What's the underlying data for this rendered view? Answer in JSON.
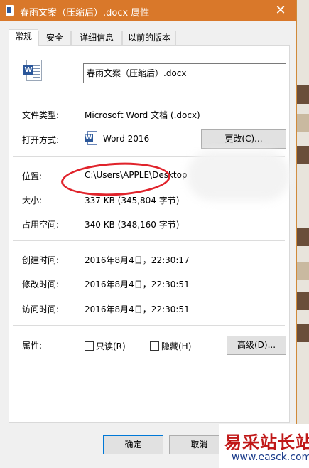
{
  "window": {
    "title": "春雨文案（压缩后）.docx 属性",
    "close_glyph": "✕"
  },
  "tabs": [
    "常规",
    "安全",
    "详细信息",
    "以前的版本"
  ],
  "file": {
    "name": "春雨文案（压缩后）.docx",
    "icon_letter": "W"
  },
  "general": {
    "type_label": "文件类型:",
    "type_value": "Microsoft Word 文档 (.docx)",
    "opens_label": "打开方式:",
    "opens_value": "Word 2016",
    "change_button": "更改(C)...",
    "location_label": "位置:",
    "location_value": "C:\\Users\\APPLE\\Desktop",
    "size_label": "大小:",
    "size_value": "337 KB (345,804 字节)",
    "disk_label": "占用空间:",
    "disk_value": "340 KB (348,160 字节)",
    "created_label": "创建时间:",
    "created_value": "2016年8月4日，22:30:17",
    "modified_label": "修改时间:",
    "modified_value": "2016年8月4日，22:30:51",
    "accessed_label": "访问时间:",
    "accessed_value": "2016年8月4日，22:30:51",
    "attributes_label": "属性:",
    "readonly_label": "只读(R)",
    "hidden_label": "隐藏(H)",
    "advanced_button": "高级(D)..."
  },
  "footer": {
    "ok_button": "确定",
    "cancel_button": "取消"
  },
  "watermark": {
    "line1": "易采站长站",
    "line2": "www.easck.com"
  },
  "colors": {
    "titlebar": "#d9782a",
    "annotation": "#e0232b",
    "word_blue": "#2b579a"
  }
}
